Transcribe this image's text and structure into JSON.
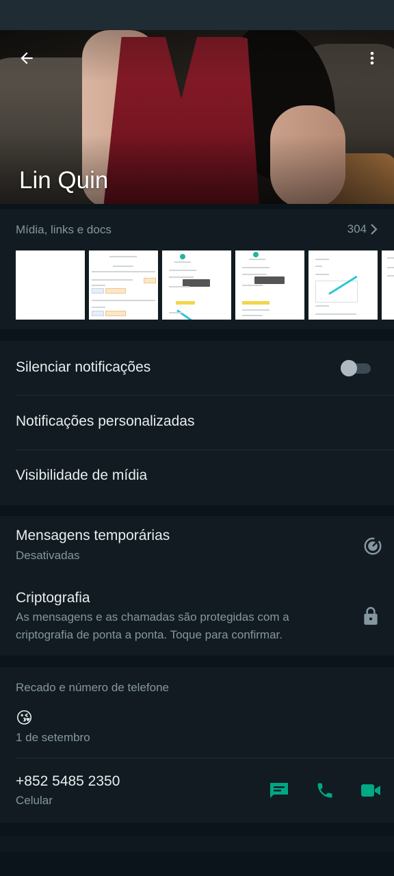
{
  "header": {
    "contact_name": "Lin Quin"
  },
  "media": {
    "title": "Mídia, links e docs",
    "count": "304"
  },
  "notifications": {
    "mute_label": "Silenciar notificações",
    "mute_enabled": false,
    "custom_label": "Notificações personalizadas",
    "visibility_label": "Visibilidade de mídia"
  },
  "privacy": {
    "disappearing_label": "Mensagens temporárias",
    "disappearing_value": "Desativadas",
    "encryption_label": "Criptografia",
    "encryption_desc_line1": "As mensagens e as chamadas são protegidas com a",
    "encryption_desc_line2": "criptografia de ponta a ponta. Toque para confirmar."
  },
  "about": {
    "section_title": "Recado e número de telefone",
    "status_emoji": "😘",
    "status_date": "1 de setembro",
    "phone_number": "+852 5485 2350",
    "phone_type": "Celular"
  },
  "colors": {
    "background": "#0b141a",
    "panel": "#111b21",
    "accent": "#00a884",
    "secondary_text": "#8696a0"
  },
  "icons": [
    "back-arrow-icon",
    "more-vert-icon",
    "chevron-right-icon",
    "timer-icon",
    "lock-icon",
    "message-icon",
    "phone-icon",
    "video-icon"
  ]
}
